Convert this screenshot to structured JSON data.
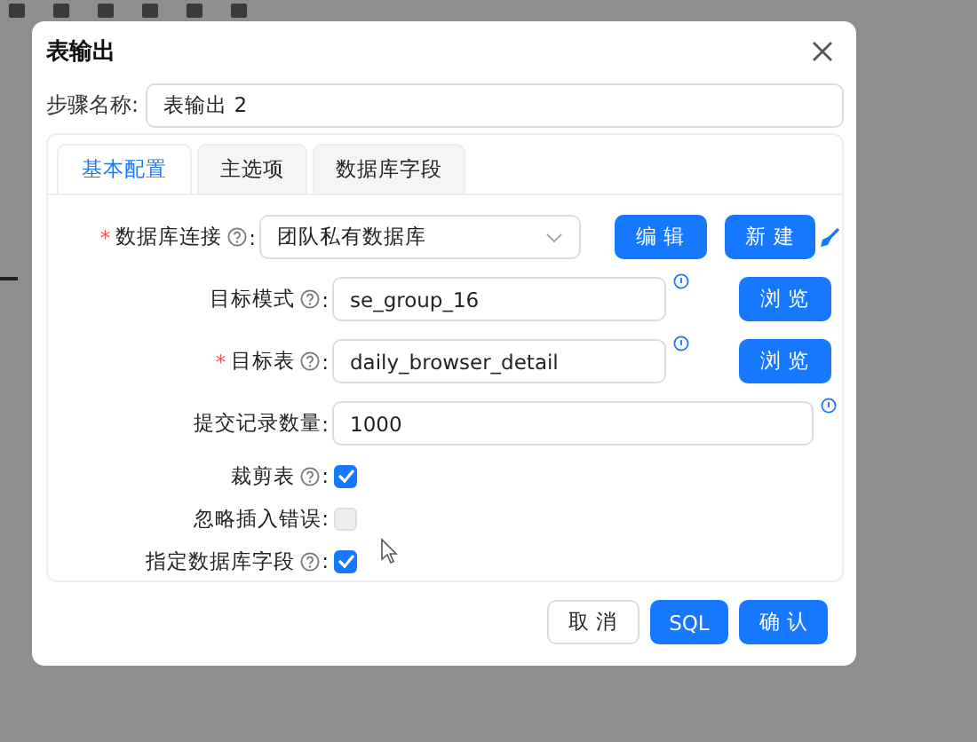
{
  "dialog": {
    "title": "表输出",
    "step_name": {
      "label": "步骤名称:",
      "value": "表输出 2"
    },
    "tabs": [
      {
        "label": "基本配置",
        "selected": true
      },
      {
        "label": "主选项",
        "selected": false
      },
      {
        "label": "数据库字段",
        "selected": false
      }
    ],
    "fields": [
      {
        "kind": "select",
        "required_mark": "*",
        "label": "数据库连接",
        "help": true,
        "colon": ":",
        "value": "团队私有数据库",
        "buttons": [
          "编 辑",
          "新 建"
        ]
      },
      {
        "kind": "input",
        "label": "目标模式",
        "help": true,
        "colon": ":",
        "value": "se_group_16",
        "info": true,
        "buttons": [
          "浏 览"
        ]
      },
      {
        "kind": "input",
        "required_mark": "*",
        "label": "目标表",
        "help": true,
        "colon": ":",
        "value": "daily_browser_detail",
        "info": true,
        "buttons": [
          "浏 览"
        ]
      },
      {
        "kind": "input",
        "label": "提交记录数量",
        "help": false,
        "colon": ":",
        "value": "1000",
        "info": true
      },
      {
        "kind": "checkbox",
        "label": "裁剪表",
        "help": true,
        "colon": ":",
        "checked": true,
        "disabled": false
      },
      {
        "kind": "checkbox",
        "label": "忽略插入错误",
        "help": false,
        "colon": ":",
        "checked": false,
        "disabled": true
      },
      {
        "kind": "checkbox",
        "label": "指定数据库字段",
        "help": true,
        "colon": ":",
        "checked": true,
        "disabled": false
      }
    ],
    "footer_buttons": [
      {
        "label": "取 消",
        "kind": "default"
      },
      {
        "label": "SQL",
        "kind": "primary"
      },
      {
        "label": "确 认",
        "kind": "primary"
      }
    ]
  }
}
